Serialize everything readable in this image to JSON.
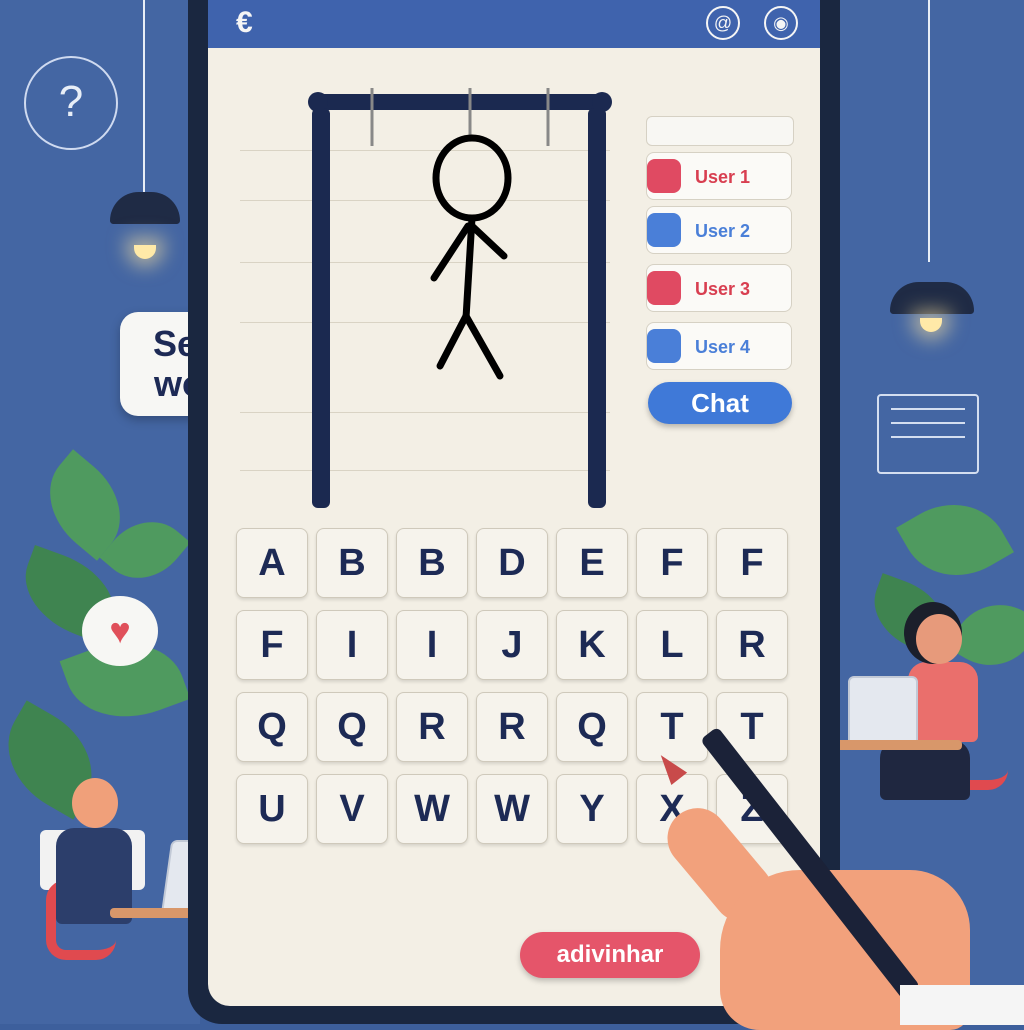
{
  "scene": {
    "bubble_text_line1": "Secret",
    "bubble_text_line2": "word?",
    "help_icon": "?",
    "heart_icon": "♥"
  },
  "topbar": {
    "back_icon": "€",
    "at_icon": "@",
    "settings_icon": "◉"
  },
  "users": [
    {
      "label": "User 1",
      "color": "#e04a62"
    },
    {
      "label": "User 2",
      "color": "#4a7fd8"
    },
    {
      "label": "User 3",
      "color": "#e04a62"
    },
    {
      "label": "User 4",
      "color": "#4a7fd8"
    }
  ],
  "chat_label": "Chat",
  "keyboard": {
    "row1": [
      "A",
      "B",
      "B",
      "D",
      "E",
      "F",
      "F"
    ],
    "row2": [
      "F",
      "I",
      "I",
      "J",
      "K",
      "L",
      "R"
    ],
    "row3": [
      "Q",
      "Q",
      "R",
      "R",
      "Q",
      "T",
      "T"
    ],
    "row4": [
      "U",
      "V",
      "W",
      "W",
      "Y",
      "X",
      "Z"
    ]
  },
  "guess_button": "adivinhar",
  "colors": {
    "background": "#3d5f9c",
    "topbar": "#3f63ad",
    "chat": "#3f79d8",
    "guess": "#e5556a",
    "screen": "#f3efe5"
  }
}
